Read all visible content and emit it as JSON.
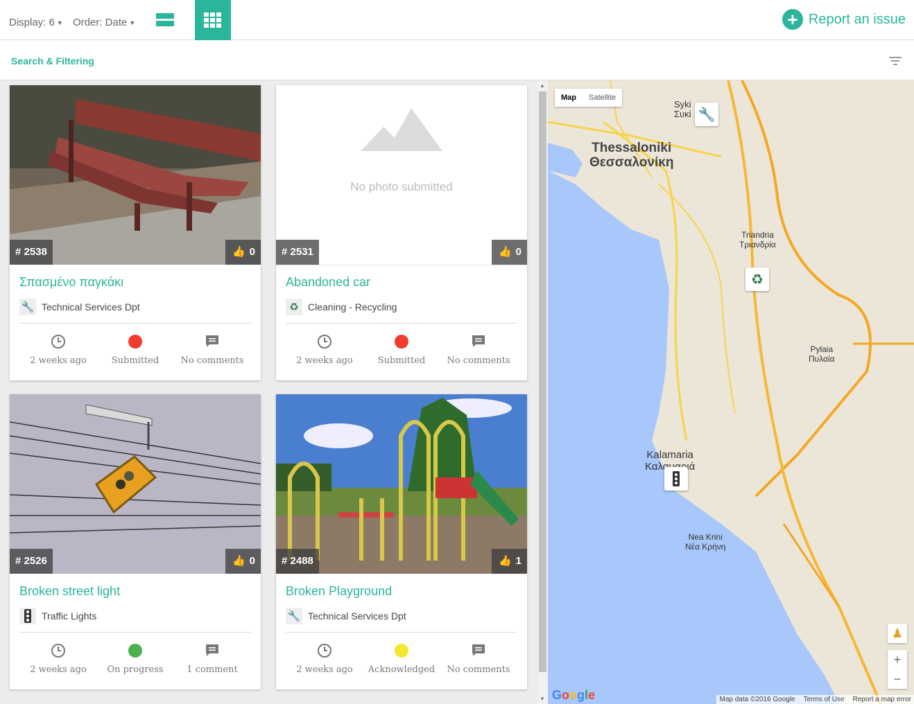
{
  "toolbar": {
    "display_label": "Display: 6",
    "order_label": "Order: Date",
    "report_label": "Report an issue"
  },
  "filter": {
    "label": "Search & Filtering"
  },
  "cards": [
    {
      "id": "# 2538",
      "likes": "0",
      "title": "Σπασμένο παγκάκι",
      "category": "Technical Services Dpt",
      "category_icon": "wrench-icon",
      "time": "2 weeks ago",
      "status": "Submitted",
      "status_color": "#f03c2c",
      "comments": "No comments"
    },
    {
      "id": "# 2531",
      "likes": "0",
      "title": "Abandoned car",
      "category": "Cleaning - Recycling",
      "category_icon": "recycle-icon",
      "time": "2 weeks ago",
      "status": "Submitted",
      "status_color": "#f03c2c",
      "comments": "No comments",
      "no_photo": "No photo submitted"
    },
    {
      "id": "# 2526",
      "likes": "0",
      "title": "Broken street light",
      "category": "Traffic Lights",
      "category_icon": "traffic-light-icon",
      "time": "2 weeks ago",
      "status": "On progress",
      "status_color": "#4caf50",
      "comments": "1 comment"
    },
    {
      "id": "# 2488",
      "likes": "1",
      "title": "Broken Playground",
      "category": "Technical Services Dpt",
      "category_icon": "wrench-icon",
      "time": "2 weeks ago",
      "status": "Acknowledged",
      "status_color": "#f5e832",
      "comments": "No comments"
    }
  ],
  "map": {
    "type_map": "Map",
    "type_satellite": "Satellite",
    "labels": {
      "thessaloniki": "Thessaloniki\nΘεσσαλονίκη",
      "syki": "Syki\nΣυκί",
      "triandria": "Triandria\nΤριανδρία",
      "pylaia": "Pylaia\nΠυλαία",
      "kalamaria": "Kalamaria\nΚαλαμαριά",
      "nea_krini": "Nea Krini\nΝέα Κρήνη"
    },
    "google": "Google",
    "attribution_data": "Map data ©2016 Google",
    "attribution_terms": "Terms of Use",
    "attribution_report": "Report a map error",
    "zoom_in": "+",
    "zoom_out": "−"
  }
}
